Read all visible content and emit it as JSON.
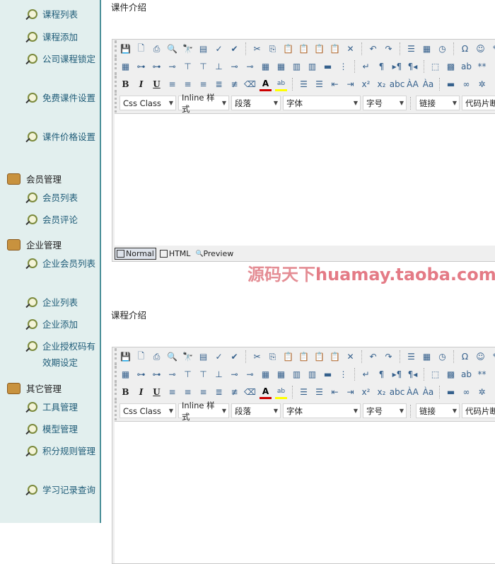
{
  "sidebar": {
    "items": [
      {
        "type": "item",
        "label": "课程列表"
      },
      {
        "type": "item",
        "label": "课程添加"
      },
      {
        "type": "item",
        "label": "公司课程锁定"
      },
      {
        "type": "item",
        "label": "免费课件设置"
      },
      {
        "type": "item",
        "label": "课件价格设置"
      },
      {
        "type": "group",
        "label": "会员管理"
      },
      {
        "type": "item",
        "label": "会员列表"
      },
      {
        "type": "item",
        "label": "会员评论"
      },
      {
        "type": "group",
        "label": "企业管理"
      },
      {
        "type": "item",
        "label": "企业会员列表"
      },
      {
        "type": "item",
        "label": "企业列表"
      },
      {
        "type": "item",
        "label": "企业添加"
      },
      {
        "type": "item",
        "label": "企业授权码有效期设定"
      },
      {
        "type": "group",
        "label": "其它管理"
      },
      {
        "type": "item",
        "label": "工具管理"
      },
      {
        "type": "item",
        "label": "模型管理"
      },
      {
        "type": "item",
        "label": "积分规则管理"
      },
      {
        "type": "item",
        "label": "学习记录查询"
      }
    ]
  },
  "sections": [
    {
      "label": "课件介绍"
    },
    {
      "label": "课程介绍"
    }
  ],
  "toolbar": {
    "row1": [
      [
        "save",
        "💾"
      ],
      [
        "new",
        "🗋"
      ],
      [
        "print",
        "⎙"
      ],
      [
        "preview",
        "🔍"
      ],
      [
        "find",
        "🔭"
      ],
      [
        "replace",
        "▤"
      ],
      [
        "clean",
        "✓"
      ],
      [
        "spellcheck",
        "✔"
      ],
      "|",
      [
        "cut",
        "✂"
      ],
      [
        "copy",
        "⎘"
      ],
      [
        "paste",
        "📋"
      ],
      [
        "paste-text",
        "📋"
      ],
      [
        "paste-word",
        "📋"
      ],
      [
        "paste-html",
        "📋"
      ],
      [
        "delete",
        "✕"
      ],
      "|",
      [
        "undo",
        "↶"
      ],
      [
        "redo",
        "↷"
      ],
      "|",
      [
        "page-break",
        "☰"
      ],
      [
        "date",
        "▦"
      ],
      [
        "time",
        "◷"
      ],
      "|",
      [
        "special-char",
        "Ω"
      ],
      [
        "emoticon",
        "☺"
      ],
      [
        "more",
        "✎"
      ]
    ],
    "row2": [
      [
        "table",
        "▦"
      ],
      [
        "insert-row",
        "⊶"
      ],
      [
        "insert-row-after",
        "⊶"
      ],
      [
        "insert-col",
        "⊸"
      ],
      [
        "insert-col-after",
        "⊤"
      ],
      [
        "merge",
        "⊤"
      ],
      [
        "split",
        "⊥"
      ],
      [
        "delete-row",
        "⊸"
      ],
      [
        "delete-col",
        "⊸"
      ],
      [
        "table-props",
        "▦"
      ],
      [
        "cell-props",
        "▦"
      ],
      [
        "row-props",
        "▥"
      ],
      [
        "col-props",
        "▥"
      ],
      [
        "merge-cells",
        "▬"
      ],
      [
        "split-cells",
        "⋮"
      ],
      "|",
      [
        "line-break",
        "↵"
      ],
      [
        "paragraph",
        "¶"
      ],
      [
        "ltr",
        "▸¶"
      ],
      [
        "rtl",
        "¶◂"
      ],
      "|",
      [
        "div",
        "⬚"
      ],
      [
        "form",
        "▩"
      ],
      [
        "textfield",
        "ab"
      ],
      [
        "password",
        "**"
      ],
      [
        "more2",
        "⁝"
      ]
    ],
    "row3": [
      [
        "bold",
        "B"
      ],
      [
        "italic",
        "I"
      ],
      [
        "underline",
        "U"
      ],
      [
        "align-left",
        "≡"
      ],
      [
        "align-center",
        "≡"
      ],
      [
        "align-right",
        "≡"
      ],
      [
        "justify",
        "≣"
      ],
      [
        "strike-align",
        "≢"
      ],
      [
        "eraser",
        "⌫"
      ],
      [
        "font-color",
        "A"
      ],
      [
        "highlight",
        "ab"
      ],
      "|",
      [
        "ordered-list",
        "☰"
      ],
      [
        "unordered-list",
        "☰"
      ],
      [
        "outdent",
        "⇤"
      ],
      [
        "indent",
        "⇥"
      ],
      [
        "superscript",
        "x²"
      ],
      [
        "subscript",
        "x₂"
      ],
      [
        "strikethrough",
        "abc"
      ],
      [
        "uppercase",
        "ÀA"
      ],
      [
        "lowercase",
        "Àa"
      ],
      "|",
      [
        "hr",
        "▬"
      ],
      [
        "link",
        "∞"
      ],
      [
        "unlink",
        "✲"
      ]
    ],
    "selects": [
      {
        "label": "Css Class",
        "w": 80
      },
      {
        "label": "Inline 样式",
        "w": 72
      },
      {
        "label": "段落",
        "w": 70
      },
      {
        "label": "字体",
        "w": 110
      },
      {
        "label": "字号",
        "w": 62
      },
      "|",
      {
        "label": "链接",
        "w": 62
      },
      {
        "label": "代码片断",
        "w": 80
      }
    ]
  },
  "modes": [
    {
      "label": "Normal",
      "active": true
    },
    {
      "label": "HTML",
      "active": false
    },
    {
      "label": "Preview",
      "active": false
    }
  ],
  "watermark": {
    "cn": "源码天下",
    "en": "huamay.taoba.com",
    "color": "#e47b86"
  }
}
